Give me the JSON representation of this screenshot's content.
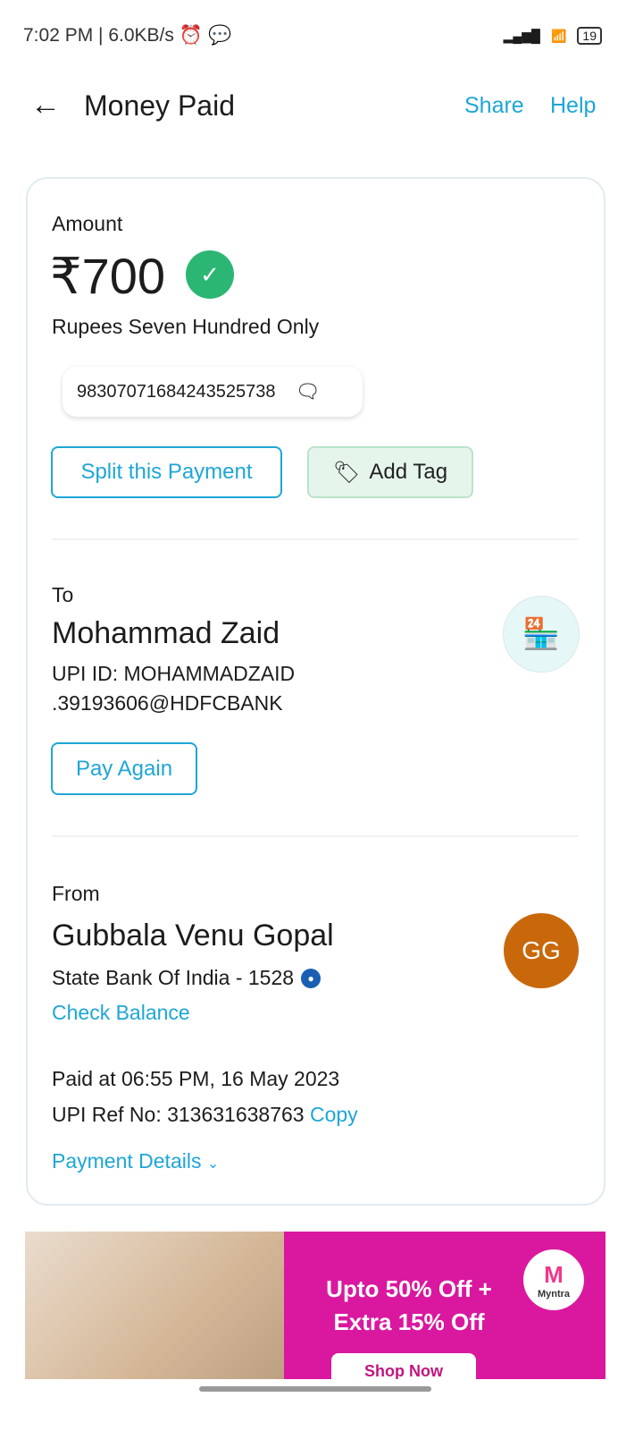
{
  "status": {
    "time": "7:02 PM | 6.0KB/s",
    "battery": "19"
  },
  "header": {
    "title": "Money Paid",
    "share": "Share",
    "help": "Help"
  },
  "amount": {
    "label": "Amount",
    "value": "₹700",
    "words": "Rupees Seven Hundred Only",
    "note": "98307071684243525738",
    "split": "Split this Payment",
    "tag": "Add Tag"
  },
  "to": {
    "label": "To",
    "name": "Mohammad Zaid",
    "upi1": "UPI ID: MOHAMMADZAID",
    "upi2": ".39193606@HDFCBANK",
    "pay_again": "Pay Again"
  },
  "from": {
    "label": "From",
    "name": "Gubbala Venu Gopal",
    "bank": "State Bank Of India - 1528",
    "check": "Check Balance",
    "initials": "GG"
  },
  "meta": {
    "paid_at": "Paid at 06:55 PM, 16 May 2023",
    "ref": "UPI Ref No: 313631638763",
    "copy": "Copy",
    "details": "Payment Details"
  },
  "banner": {
    "line1": "Upto 50% Off +",
    "line2": "Extra 15% Off",
    "cta": "Shop Now",
    "brand": "Myntra"
  },
  "colors": {
    "accent": "#1ea6d6",
    "verified": "#2bb673",
    "avatar": "#c8680a",
    "banner": "#d9189f"
  }
}
